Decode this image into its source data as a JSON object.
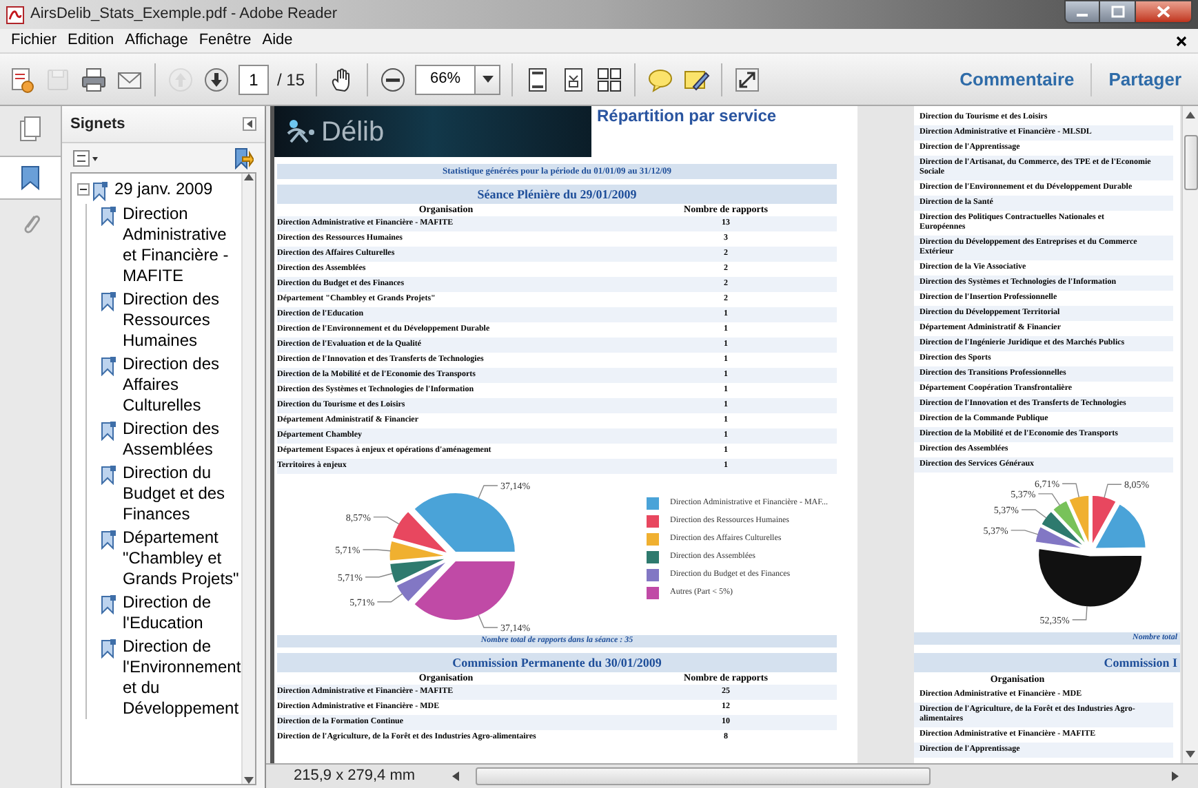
{
  "window": {
    "title": "AirsDelib_Stats_Exemple.pdf - Adobe Reader"
  },
  "menu": [
    "Fichier",
    "Edition",
    "Affichage",
    "Fenêtre",
    "Aide"
  ],
  "toolbar": {
    "items": [
      {
        "kind": "create",
        "disabled": false
      },
      {
        "kind": "save",
        "disabled": true
      },
      {
        "kind": "print",
        "disabled": false
      },
      {
        "kind": "email",
        "disabled": false
      },
      {
        "kind": "prev",
        "disabled": true
      },
      {
        "kind": "next",
        "disabled": false
      },
      {
        "kind": "page",
        "value": "1",
        "count": "/ 15"
      },
      {
        "kind": "hand",
        "disabled": false
      },
      {
        "kind": "zoom-out",
        "disabled": false
      },
      {
        "kind": "zoom",
        "value": "66%"
      },
      {
        "kind": "fit-page",
        "disabled": false
      },
      {
        "kind": "fit-width",
        "disabled": false
      },
      {
        "kind": "two-page",
        "disabled": false
      },
      {
        "kind": "comment",
        "disabled": false
      },
      {
        "kind": "sign",
        "disabled": false
      },
      {
        "kind": "fullscreen",
        "disabled": false
      }
    ],
    "links": [
      "Commentaire",
      "Partager"
    ]
  },
  "sidebar": {
    "title": "Signets",
    "items": [
      {
        "label": "29 janv. 2009",
        "expanded": true,
        "children": [
          {
            "label": "Direction Administrative et Financière - MAFITE"
          },
          {
            "label": "Direction des Ressources Humaines"
          },
          {
            "label": "Direction des Affaires Culturelles"
          },
          {
            "label": "Direction des Assemblées"
          },
          {
            "label": "Direction du Budget et des Finances"
          },
          {
            "label": "Département \"Chambley et Grands Projets\""
          },
          {
            "label": "Direction de l'Education"
          },
          {
            "label": "Direction de l'Environnement et du Développement"
          }
        ]
      }
    ]
  },
  "page_1": {
    "logo": "Délib",
    "heading": "Répartition par service",
    "period": "Statistique générées pour la période du 01/01/09 au 31/12/09",
    "sections": [
      {
        "title": "Séance Plénière du 29/01/2009",
        "columns": [
          "Organisation",
          "Nombre de rapports"
        ],
        "rows": [
          [
            "Direction Administrative et Financière - MAFITE",
            "13"
          ],
          [
            "Direction des Ressources Humaines",
            "3"
          ],
          [
            "Direction des Affaires Culturelles",
            "2"
          ],
          [
            "Direction des Assemblées",
            "2"
          ],
          [
            "Direction du Budget et des Finances",
            "2"
          ],
          [
            "Département \"Chambley et Grands Projets\"",
            "2"
          ],
          [
            "Direction de l'Education",
            "1"
          ],
          [
            "Direction de l'Environnement et du Développement Durable",
            "1"
          ],
          [
            "Direction de l'Evaluation et de la Qualité",
            "1"
          ],
          [
            "Direction de l'Innovation et des Transferts de Technologies",
            "1"
          ],
          [
            "Direction de la Mobilité et de l'Economie des Transports",
            "1"
          ],
          [
            "Direction des Systèmes et Technologies de l'Information",
            "1"
          ],
          [
            "Direction du Tourisme et des Loisirs",
            "1"
          ],
          [
            "Département Administratif & Financier",
            "1"
          ],
          [
            "Département Chambley",
            "1"
          ],
          [
            "Département Espaces à enjeux et opérations d'aménagement",
            "1"
          ],
          [
            "Territoires à enjeux",
            "1"
          ]
        ],
        "chart_data": {
          "type": "pie",
          "categories": [
            "Direction Administrative et Financière - MAF...",
            "Direction des Ressources Humaines",
            "Direction des Affaires Culturelles",
            "Direction des Assemblées",
            "Direction du Budget et des Finances",
            "Autres (Part < 5%)"
          ],
          "values": [
            37.14,
            8.57,
            5.71,
            5.71,
            5.71,
            37.14
          ],
          "value_labels": [
            "37,14%",
            "8,57%",
            "5,71%",
            "5,71%",
            "5,71%",
            "37,14%"
          ],
          "legend": "right"
        },
        "total": "Nombre total de rapports dans la séance : 35"
      },
      {
        "title": "Commission Permanente du 30/01/2009",
        "columns": [
          "Organisation",
          "Nombre de rapports"
        ],
        "rows": [
          [
            "Direction Administrative et Financière - MAFITE",
            "25"
          ],
          [
            "Direction Administrative et Financière - MDE",
            "12"
          ],
          [
            "Direction de la Formation Continue",
            "10"
          ],
          [
            "Direction de l'Agriculture, de la Forêt et des Industries Agro-alimentaires",
            "8"
          ]
        ]
      }
    ]
  },
  "page_2": {
    "rows": [
      "Direction du Tourisme et des Loisirs",
      "Direction Administrative et Financière - MLSDL",
      "Direction de l'Apprentissage",
      "Direction de l'Artisanat, du Commerce, des TPE et de l'Economie Sociale",
      "Direction de l'Environnement et du Développement Durable",
      "Direction de la Santé",
      "Direction des Politiques Contractuelles Nationales et Européennes",
      "Direction du Développement des Entreprises et du Commerce Extérieur",
      "Direction de la Vie Associative",
      "Direction des Systèmes et Technologies de l'Information",
      "Direction de l'Insertion Professionnelle",
      "Direction du Développement Territorial",
      "Département Administratif & Financier",
      "Direction de l'Ingénierie Juridique et des Marchés Publics",
      "Direction des Sports",
      "Direction des Transitions Professionnelles",
      "Département Coopération Transfrontalière",
      "Direction de l'Innovation et des Transferts de Technologies",
      "Direction de la Commande Publique",
      "Direction de la Mobilité et de l'Economie des Transports",
      "Direction des Assemblées",
      "Direction des Services Généraux"
    ],
    "chart_data": {
      "type": "pie",
      "values": [
        8.05,
        16.78,
        52.35,
        5.37,
        5.37,
        5.37,
        6.71
      ],
      "value_labels": [
        "8,05%",
        null,
        "52,35%",
        "5,37%",
        "5,37%",
        "5,37%",
        "6,71%"
      ]
    },
    "total": "Nombre total",
    "section_title": "Commission I",
    "column": "Organisation",
    "rows_2": [
      "Direction Administrative et Financière - MDE",
      "Direction de l'Agriculture, de la Forêt et des Industries Agro-alimentaires",
      "Direction Administrative et Financière - MAFITE",
      "Direction de l'Apprentissage"
    ]
  },
  "status_bar": {
    "page_size": "215,9 x 279,4 mm"
  }
}
